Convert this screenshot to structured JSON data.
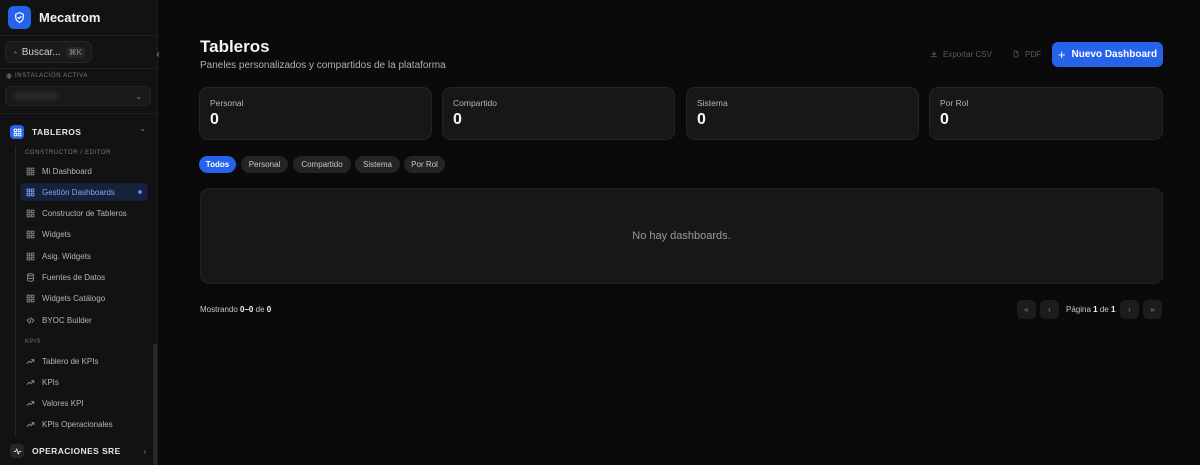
{
  "sidebar": {
    "brand": "Mecatrom",
    "search_placeholder": "Buscar...",
    "search_shortcut": "⌘K",
    "installation_label": "INSTALACIÓN ACTIVA",
    "group_tableros": "TABLEROS",
    "section_constructor": "CONSTRUCTOR / EDITOR",
    "constructor_items": [
      {
        "label": "Mi Dashboard",
        "icon": "grid-icon"
      },
      {
        "label": "Gestión Dashboards",
        "icon": "grid-icon"
      },
      {
        "label": "Constructor de Tableros",
        "icon": "grid-icon"
      },
      {
        "label": "Widgets",
        "icon": "grid-icon"
      },
      {
        "label": "Asig. Widgets",
        "icon": "grid-icon"
      },
      {
        "label": "Fuentes de Datos",
        "icon": "database-icon"
      },
      {
        "label": "Widgets Catálogo",
        "icon": "grid-icon"
      },
      {
        "label": "BYOC Builder",
        "icon": "code-icon"
      }
    ],
    "section_kpis": "KPIS",
    "kpi_items": [
      {
        "label": "Tablero de KPIs",
        "icon": "trend-icon"
      },
      {
        "label": "KPIs",
        "icon": "trend-icon"
      },
      {
        "label": "Valores KPI",
        "icon": "trend-icon"
      },
      {
        "label": "KPIs Operacionales",
        "icon": "trend-icon"
      }
    ],
    "group_sre": "OPERACIONES SRE",
    "accent_color": "#2563eb"
  },
  "header": {
    "title": "Tableros",
    "subtitle": "Paneles personalizados y compartidos de la plataforma",
    "export_csv": "Exportar CSV",
    "pdf": "PDF",
    "new_dashboard": "Nuevo Dashboard"
  },
  "stats": [
    {
      "label": "Personal",
      "value": "0"
    },
    {
      "label": "Compartido",
      "value": "0"
    },
    {
      "label": "Sistema",
      "value": "0"
    },
    {
      "label": "Por Rol",
      "value": "0"
    }
  ],
  "filters": [
    "Todos",
    "Personal",
    "Compartido",
    "Sistema",
    "Por Rol"
  ],
  "active_filter": "Todos",
  "empty_message": "No hay dashboards.",
  "footer": {
    "showing_prefix": "Mostrando",
    "range": "0–0",
    "of": "de",
    "total": "0",
    "page_label": "Página",
    "page": "1",
    "page_of": "de",
    "pages": "1"
  }
}
